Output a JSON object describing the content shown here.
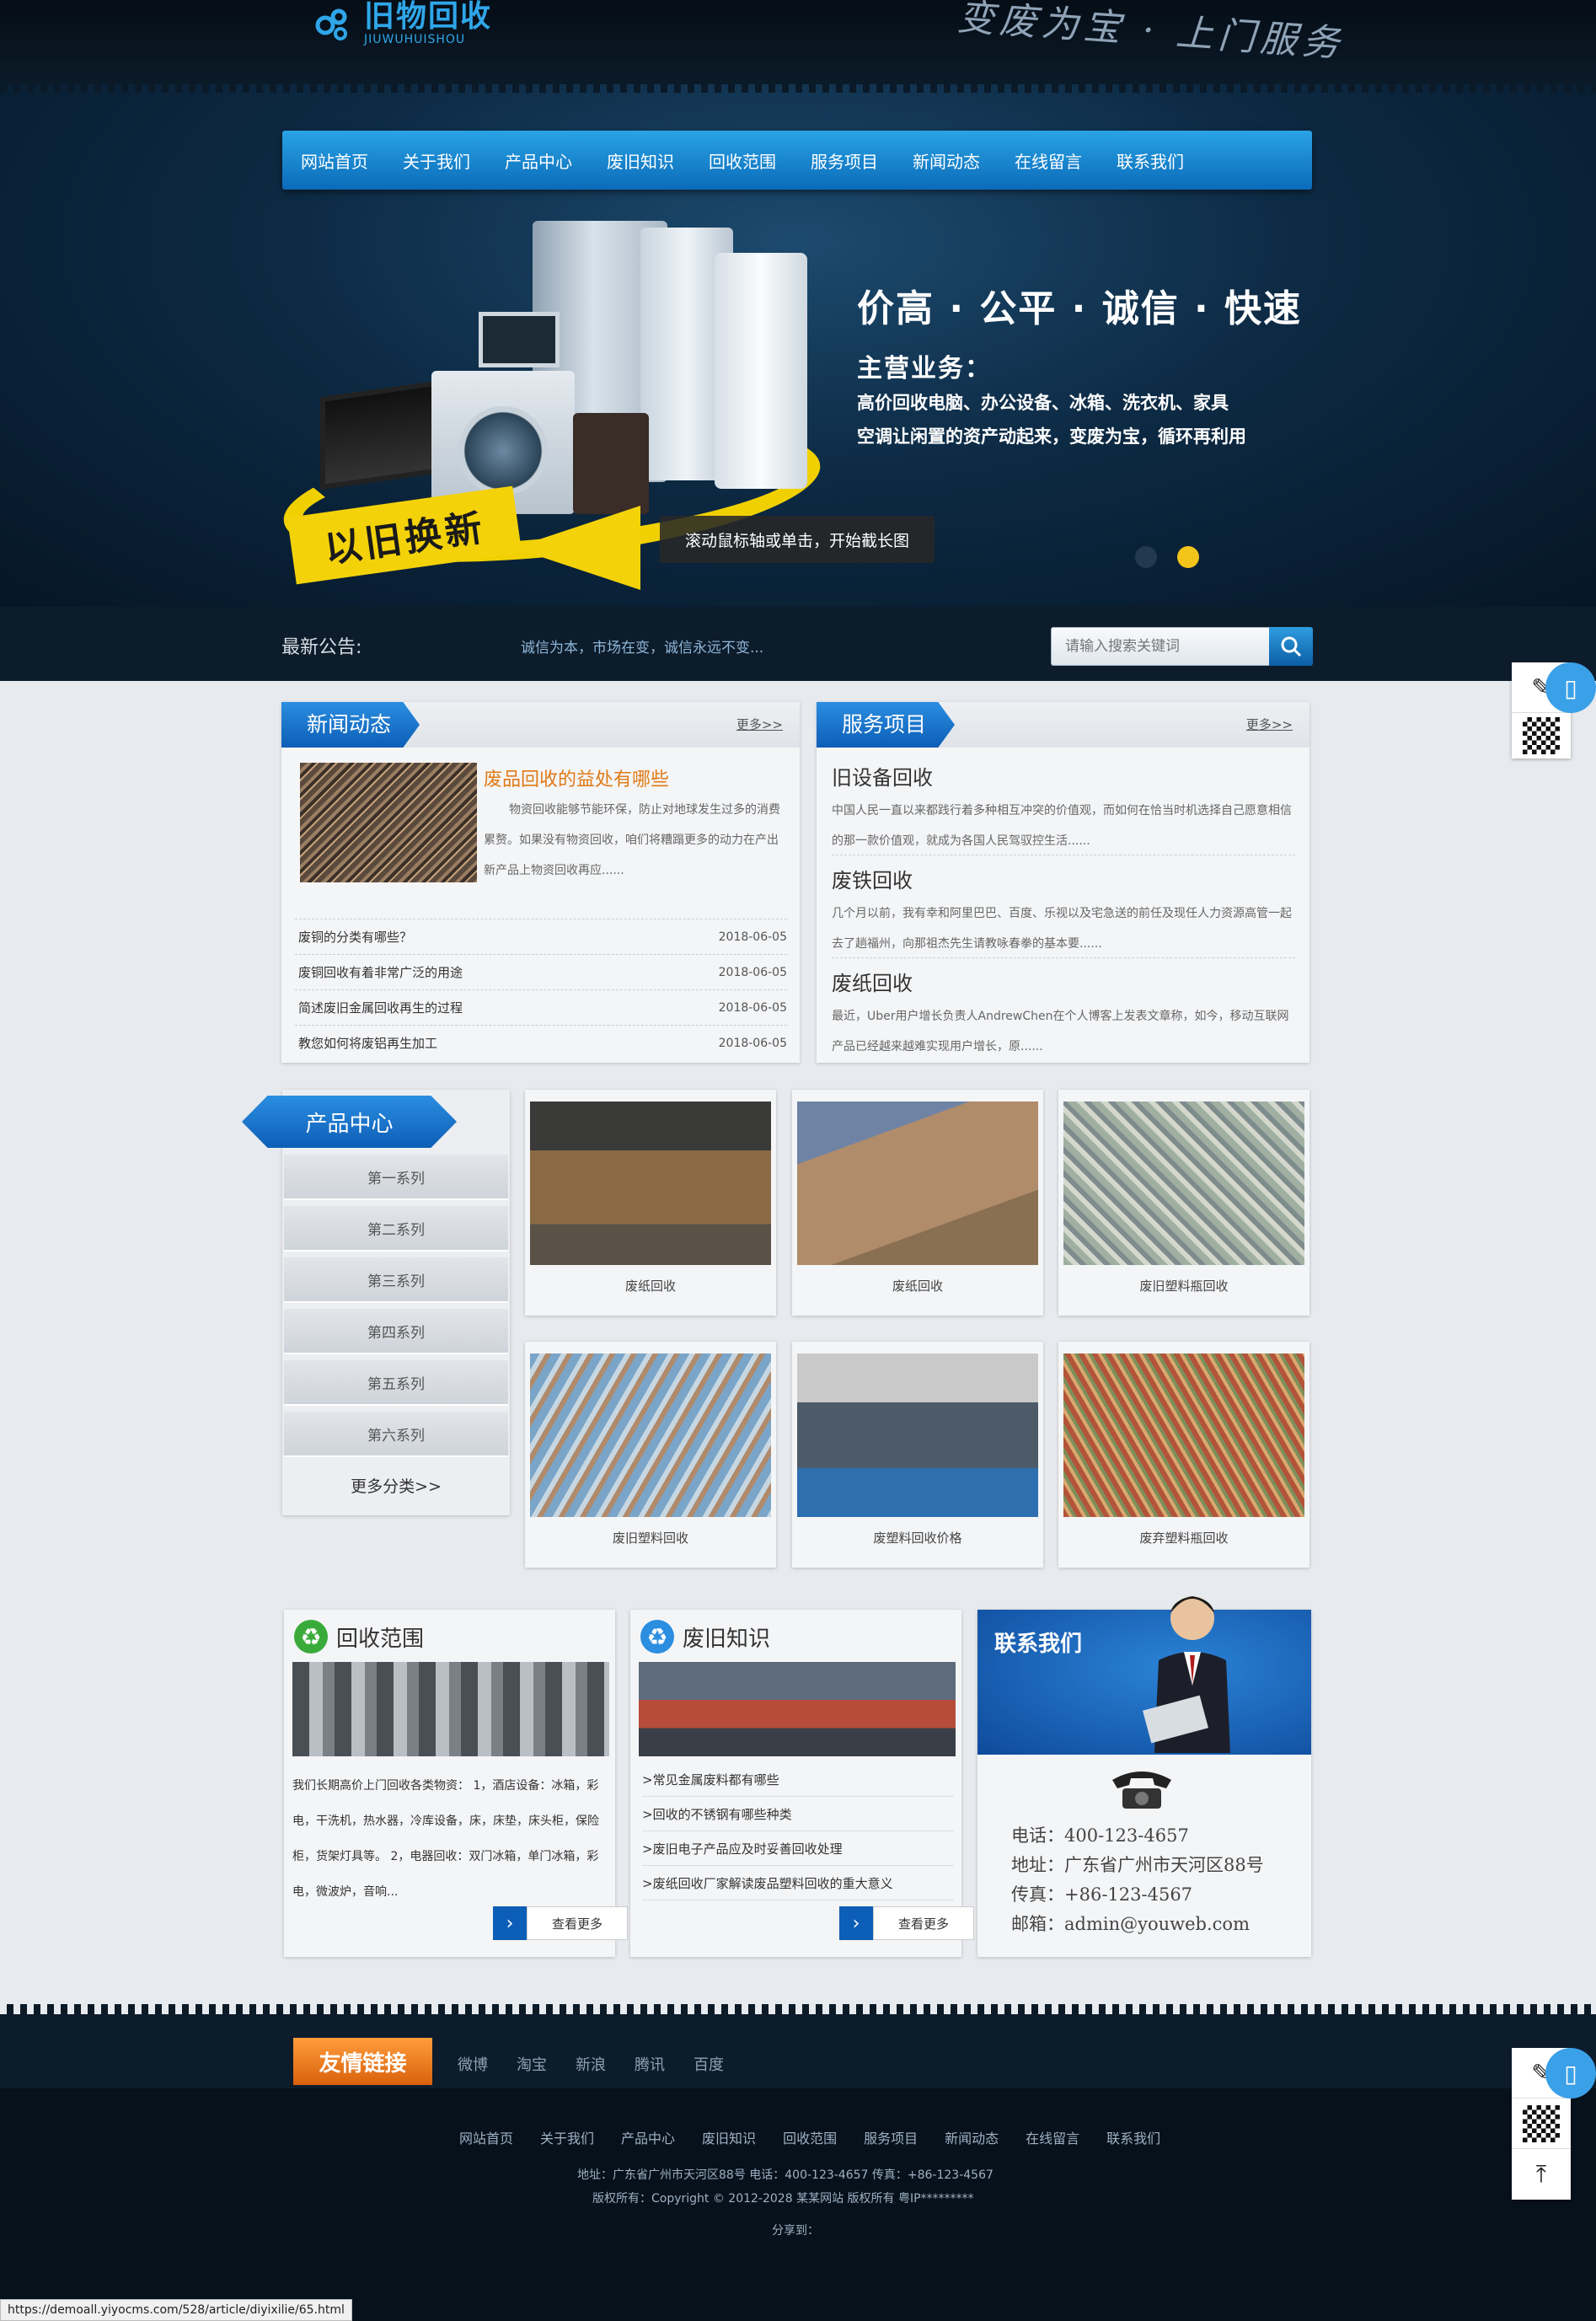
{
  "header": {
    "logo_cn": "旧物回收",
    "logo_en": "JIUWUHUISHOU",
    "slogan": "变废为宝 · 上门服务"
  },
  "nav": [
    "网站首页",
    "关于我们",
    "产品中心",
    "废旧知识",
    "回收范围",
    "服务项目",
    "新闻动态",
    "在线留言",
    "联系我们"
  ],
  "banner": {
    "badge": "以旧换新",
    "headline": "价高 · 公平 · 诚信 · 快速",
    "business_title": "主营业务：",
    "line1": "高价回收电脑、办公设备、冰箱、洗衣机、家具",
    "line2": "空调让闲置的资产动起来，变废为宝，循环再利用",
    "tooltip": "滚动鼠标轴或单击，开始截长图"
  },
  "notice": {
    "label": "最新公告:",
    "text": "诚信为本，市场在变，诚信永远不变...",
    "search_placeholder": "请输入搜索关键词"
  },
  "news": {
    "title": "新闻动态",
    "more": "更多>>",
    "featured_title": "废品回收的益处有哪些",
    "featured_desc": "物资回收能够节能环保，防止对地球发生过多的消费累赘。如果没有物资回收，咱们将糟蹋更多的动力在产出新产品上物资回收再应......",
    "items": [
      {
        "title": "废铜的分类有哪些？",
        "date": "2018-06-05"
      },
      {
        "title": "废铜回收有着非常广泛的用途",
        "date": "2018-06-05"
      },
      {
        "title": "简述废旧金属回收再生的过程",
        "date": "2018-06-05"
      },
      {
        "title": "教您如何将废铝再生加工",
        "date": "2018-06-05"
      }
    ]
  },
  "service": {
    "title": "服务项目",
    "more": "更多>>",
    "items": [
      {
        "title": "旧设备回收",
        "desc": "中国人民一直以来都践行着多种相互冲突的价值观，而如何在恰当时机选择自己愿意相信的那一款价值观，就成为各国人民驾驭控生活......"
      },
      {
        "title": "废铁回收",
        "desc": "几个月以前，我有幸和阿里巴巴、百度、乐视以及宅急送的前任及现任人力资源高管一起去了趟福州，向那祖杰先生请教咏春拳的基本要......"
      },
      {
        "title": "废纸回收",
        "desc": "最近，Uber用户增长负责人AndrewChen在个人博客上发表文章称，如今，移动互联网产品已经越来越难实现用户增长，原......"
      }
    ]
  },
  "products": {
    "title": "产品中心",
    "categories": [
      "第一系列",
      "第二系列",
      "第三系列",
      "第四系列",
      "第五系列",
      "第六系列"
    ],
    "more": "更多分类>>",
    "items": [
      {
        "caption": "废纸回收"
      },
      {
        "caption": "废纸回收"
      },
      {
        "caption": "废旧塑料瓶回收"
      },
      {
        "caption": "废旧塑料回收"
      },
      {
        "caption": "废塑料回收价格"
      },
      {
        "caption": "废弃塑料瓶回收"
      }
    ]
  },
  "scope": {
    "title": "回收范围",
    "text": "我们长期高价上门回收各类物资： 1，酒店设备：冰箱，彩电，干洗机，热水器，冷库设备，床，床垫，床头柜，保险柜，货架灯具等。 2，电器回收：双门冰箱，单门冰箱，彩电，微波炉，音响...",
    "more": "查看更多"
  },
  "knowledge": {
    "title": "废旧知识",
    "links": [
      ">常见金属废料都有哪些",
      ">回收的不锈钢有哪些种类",
      ">废旧电子产品应及时妥善回收处理",
      ">废纸回收厂家解读废品塑料回收的重大意义"
    ],
    "more": "查看更多"
  },
  "contact": {
    "title": "联系我们",
    "phone": "电话：400-123-4657",
    "address": "地址：广东省广州市天河区88号",
    "fax": "传真：+86-123-4567",
    "email": "邮箱：admin@youweb.com"
  },
  "footer": {
    "friend_title": "友情链接",
    "friend_links": [
      "微博",
      "淘宝",
      "新浪",
      "腾讯",
      "百度"
    ],
    "nav": [
      "网站首页",
      "关于我们",
      "产品中心",
      "废旧知识",
      "回收范围",
      "服务项目",
      "新闻动态",
      "在线留言",
      "联系我们"
    ],
    "address_line": "地址：广东省广州市天河区88号  电话：400-123-4657  传真：+86-123-4567",
    "copyright": "版权所有：Copyright © 2012-2028 某某网站 版权所有  粤IP*********",
    "share": "分享到："
  },
  "status_url": "https://demoall.yiyocms.com/528/article/diyixilie/65.html",
  "colors": {
    "accent_blue": "#0d5eb6",
    "orange": "#e07a16",
    "dark_bg": "#0d1c2b"
  }
}
